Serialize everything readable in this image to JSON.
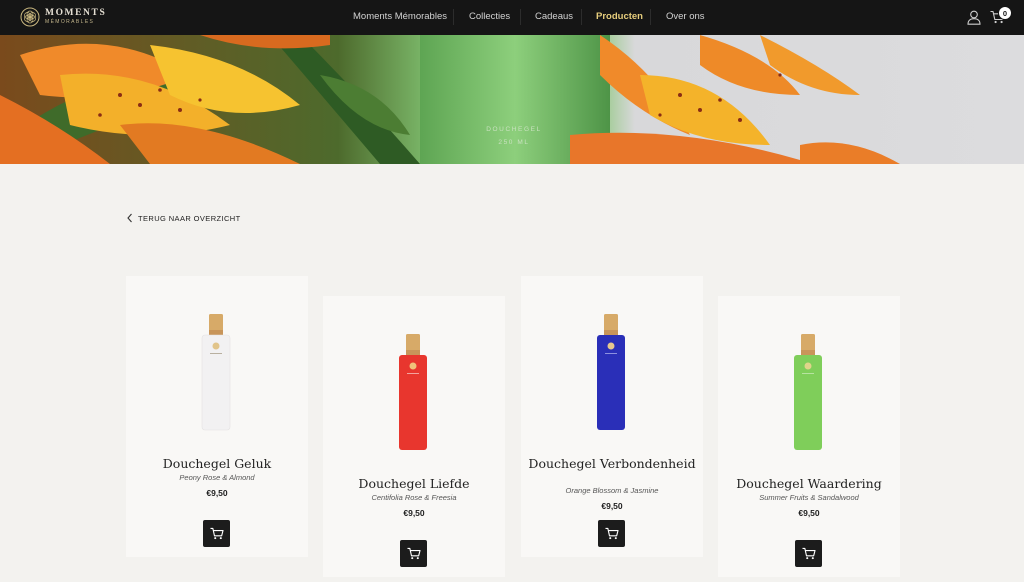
{
  "brand": {
    "name": "MOMENTS",
    "tagline": "MÉMORABLES"
  },
  "nav": [
    {
      "label": "Moments Mémorables",
      "active": false
    },
    {
      "label": "Collecties",
      "active": false
    },
    {
      "label": "Cadeaus",
      "active": false
    },
    {
      "label": "Producten",
      "active": true
    },
    {
      "label": "Over ons",
      "active": false
    }
  ],
  "header": {
    "cart_count": "0",
    "user_icon": "user-icon",
    "cart_icon": "cart-icon"
  },
  "banner": {
    "line1": "DOUCHEGEL",
    "line2": "250 ML"
  },
  "back_link": {
    "label": "TERUG NAAR OVERZICHT"
  },
  "colors": {
    "accent": "#e6cd7c",
    "topbar": "#151515",
    "background": "#f3f2ef",
    "card": "#f9f8f6"
  },
  "products": [
    {
      "name": "Douchegel Geluk",
      "notes": "Peony Rose & Almond",
      "price": "€9,50",
      "bottle_color": "#f2f1f2"
    },
    {
      "name": "Douchegel Liefde",
      "notes": "Centifolia Rose & Freesia",
      "price": "€9,50",
      "bottle_color": "#e8362e"
    },
    {
      "name": "Douchegel Verbondenheid",
      "notes": "Orange Blossom & Jasmine",
      "price": "€9,50",
      "bottle_color": "#2a2fb8"
    },
    {
      "name": "Douchegel Waardering",
      "notes": "Summer Fruits & Sandalwood",
      "price": "€9,50",
      "bottle_color": "#7fce5a"
    }
  ]
}
